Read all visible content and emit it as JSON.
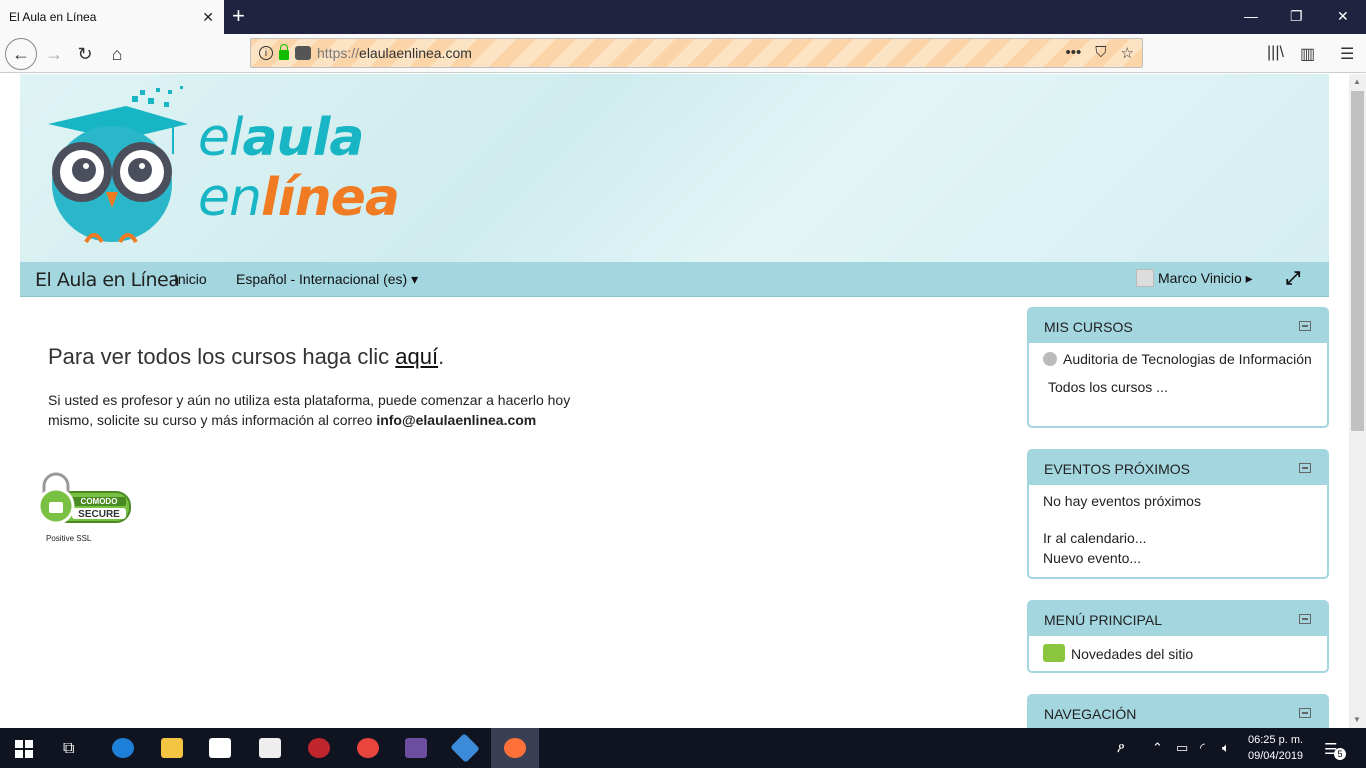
{
  "browser": {
    "tab_title": "El Aula en Línea",
    "url_protocol": "https://",
    "url_host": "elaulaenlinea.com",
    "icons": [
      "back-icon",
      "forward-icon",
      "reload-icon",
      "home-icon",
      "info-icon",
      "lock-icon",
      "more-icon",
      "pocket-icon",
      "star-icon",
      "library-icon",
      "sidebar-icon",
      "menu-icon"
    ]
  },
  "logo": {
    "line1_light": "el",
    "line1_bold": "aula",
    "line2_light": "en",
    "line2_bold": "línea"
  },
  "nav": {
    "brand": "El Aula en Línea",
    "home": "Inicio",
    "language": "Español - Internacional (es) ▾",
    "user": "Marco Vinicio ▸"
  },
  "main": {
    "heading_prefix": "Para ver todos los cursos haga clic ",
    "heading_link": "aquí",
    "heading_suffix": ".",
    "intro": "Si usted es profesor y aún no utiliza esta plataforma, puede comenzar a hacerlo hoy mismo, solicite su curso y más información al correo ",
    "email": "info@elaulaenlinea.com",
    "ssl_label": "Positive SSL"
  },
  "blocks": {
    "mis_cursos": {
      "title": "MIS CURSOS",
      "course": "Auditoria de Tecnologias de Información",
      "all": "Todos los cursos ..."
    },
    "eventos": {
      "title": "EVENTOS PRÓXIMOS",
      "none": "No hay eventos próximos",
      "calendar": "Ir al calendario...",
      "new_event": "Nuevo evento..."
    },
    "menu_principal": {
      "title": "MENÚ PRINCIPAL",
      "news": "Novedades del sitio"
    },
    "navegacion": {
      "title": "NAVEGACIÓN"
    }
  },
  "taskbar": {
    "time": "06:25 p. m.",
    "date": "09/04/2019",
    "notifications": "5"
  },
  "colors": {
    "header_bg": "#dff3f4",
    "menu_bg": "#a3d6df",
    "brand_teal": "#18b5c4",
    "brand_orange": "#f07b22"
  }
}
